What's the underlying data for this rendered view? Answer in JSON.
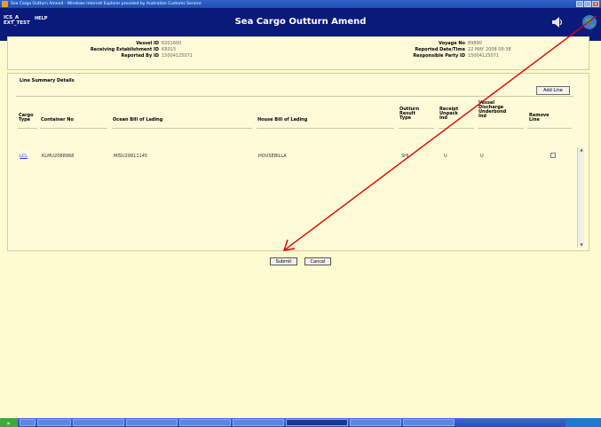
{
  "window": {
    "title": "Sea Cargo Outturn Amend - Windows Internet Explorer provided by Australian Customs Service"
  },
  "header": {
    "user_line1": "ICS_A",
    "user_line2": "EXT_TEST",
    "help_label": "HELP",
    "title": "Sea Cargo Outturn Amend"
  },
  "info": {
    "vessel_id_label": "Vessel ID",
    "vessel_id": "8201600",
    "receiving_label": "Receiving Establishment ID",
    "receiving": "KR015",
    "reported_by_label": "Reported By ID",
    "reported_by": "15004125071",
    "voyage_label": "Voyage No",
    "voyage": "89890",
    "reported_dt_label": "Reported Date/Time",
    "reported_dt": "22 MAY 2008 09:38",
    "responsible_label": "Responsible Party ID",
    "responsible": "15004125071"
  },
  "line_summary": {
    "title": "Line Summary Details",
    "add_line_label": "Add Line",
    "columns": {
      "cargo_type": [
        "Cargo",
        "Type"
      ],
      "container": "Container No",
      "ocean_bill": "Ocean Bill of Lading",
      "house_bill": "House Bill of Lading",
      "outturn": [
        "Outturn",
        "Result",
        "Type"
      ],
      "receipt": [
        "Receipt",
        "Unpack",
        "Ind"
      ],
      "vessel_discharge": [
        "Vessel",
        "Discharge",
        "Underbond",
        "Ind"
      ],
      "remove": [
        "Remove",
        "Line"
      ]
    },
    "rows": [
      {
        "cargo_type": "LCL",
        "container": "KLMU2088968",
        "ocean_bill": "MISU29811145",
        "house_bill": "HOUSEBILLA",
        "outturn": "SHI",
        "receipt": "U",
        "vessel_discharge": "U"
      }
    ]
  },
  "actions": {
    "submit_label": "Submit",
    "cancel_label": "Cancel"
  },
  "colors": {
    "app_bar": "#0a1a7a",
    "page_bg": "#fdfbd0",
    "arrow": "#e00000"
  }
}
